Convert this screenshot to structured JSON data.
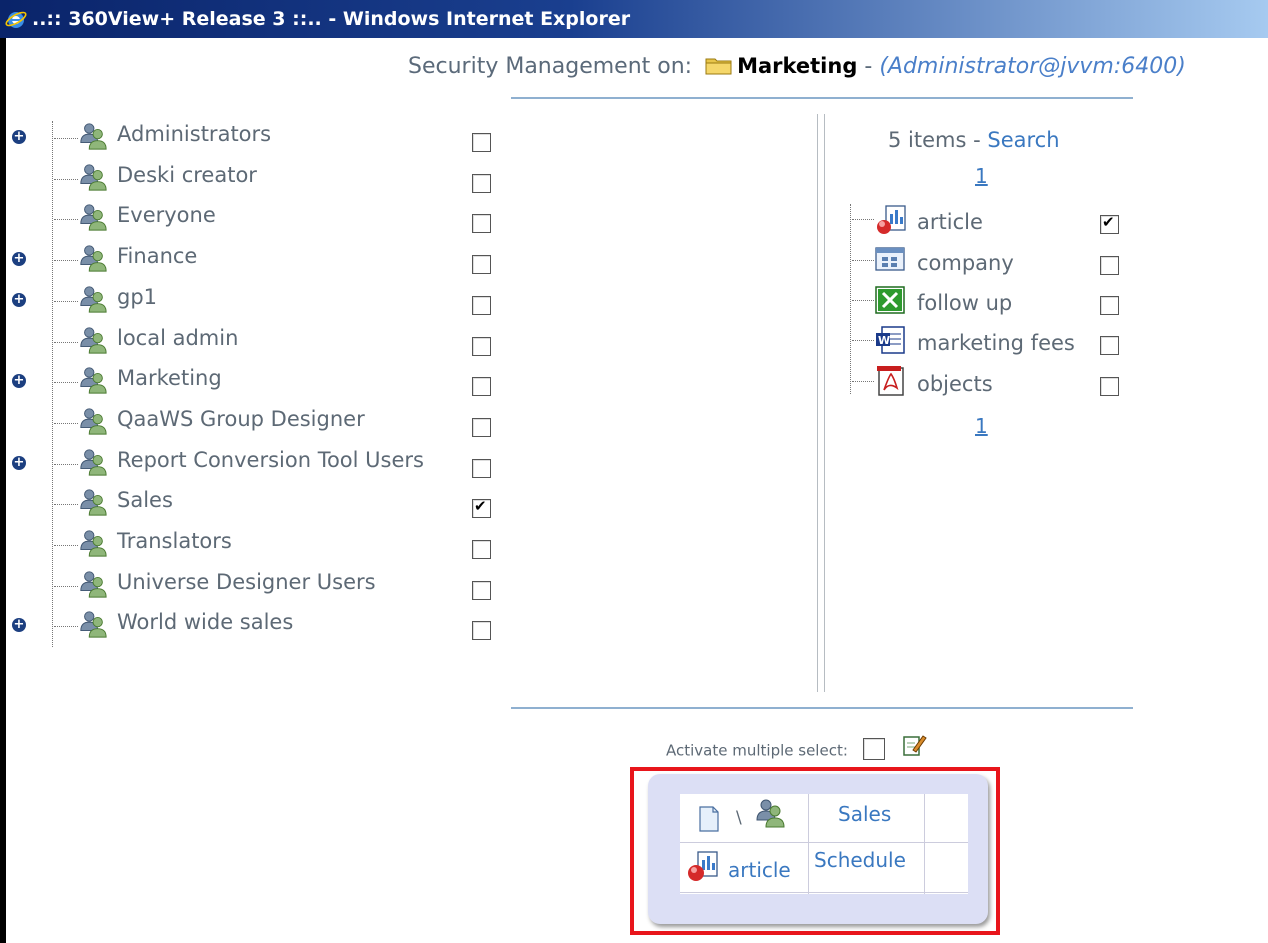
{
  "window": {
    "title": "..:: 360View+ Release 3 ::.. - Windows Internet Explorer"
  },
  "header": {
    "prefix": "Security Management on:",
    "context": "Marketing",
    "separator": "-",
    "user": "(Administrator@jvvm:6400)"
  },
  "groups": [
    {
      "label": "Administrators",
      "expandable": true,
      "checked": false
    },
    {
      "label": "Deski creator",
      "expandable": false,
      "checked": false
    },
    {
      "label": "Everyone",
      "expandable": false,
      "checked": false
    },
    {
      "label": "Finance",
      "expandable": true,
      "checked": false
    },
    {
      "label": "gp1",
      "expandable": true,
      "checked": false
    },
    {
      "label": "local admin",
      "expandable": false,
      "checked": false
    },
    {
      "label": "Marketing",
      "expandable": true,
      "checked": false
    },
    {
      "label": "QaaWS Group Designer",
      "expandable": false,
      "checked": false
    },
    {
      "label": "Report Conversion Tool Users",
      "expandable": true,
      "checked": false
    },
    {
      "label": "Sales",
      "expandable": false,
      "checked": true
    },
    {
      "label": "Translators",
      "expandable": false,
      "checked": false
    },
    {
      "label": "Universe Designer Users",
      "expandable": false,
      "checked": false
    },
    {
      "label": "World wide sales",
      "expandable": true,
      "checked": false
    }
  ],
  "items_panel": {
    "count_label": "5 items",
    "separator": "-",
    "search_label": "Search",
    "page_top": "1",
    "page_bottom": "1",
    "items": [
      {
        "label": "article",
        "icon": "webi-report-icon",
        "checked": true
      },
      {
        "label": "company",
        "icon": "table-doc-icon",
        "checked": false
      },
      {
        "label": "follow up",
        "icon": "excel-icon",
        "checked": false
      },
      {
        "label": "marketing fees",
        "icon": "word-icon",
        "checked": false
      },
      {
        "label": "objects",
        "icon": "pdf-icon",
        "checked": false
      }
    ]
  },
  "multi_select": {
    "label": "Activate multiple select:",
    "checked": false
  },
  "rights_grid": {
    "corner_separator": "\\",
    "column_header": "Sales",
    "row_label": "article",
    "cell_value": "Schedule"
  },
  "colors": {
    "link": "#3a78c0",
    "text": "#5d6975",
    "highlight_box": "#e8151b",
    "panel": "#dcdff5"
  }
}
